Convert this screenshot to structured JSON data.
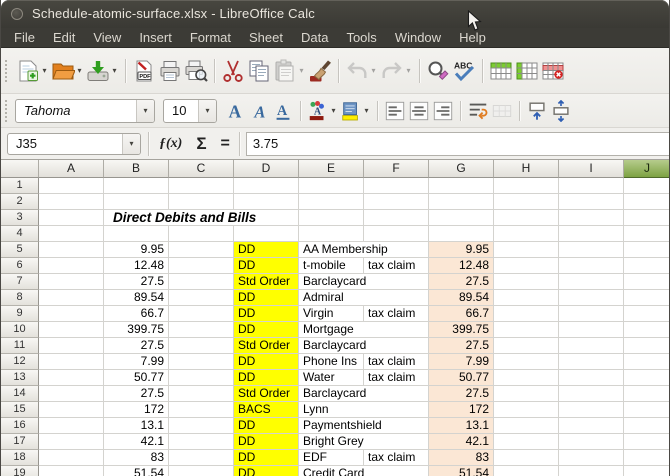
{
  "window": {
    "title": "Schedule-atomic-surface.xlsx - LibreOffice Calc"
  },
  "menubar": {
    "items": [
      "File",
      "Edit",
      "View",
      "Insert",
      "Format",
      "Sheet",
      "Data",
      "Tools",
      "Window",
      "Help"
    ]
  },
  "standard_toolbar": [
    {
      "icon": "new-document",
      "dropdown": true
    },
    {
      "icon": "open",
      "dropdown": true
    },
    {
      "icon": "save",
      "dropdown": true
    },
    {
      "type": "separator"
    },
    {
      "icon": "export-pdf"
    },
    {
      "icon": "print"
    },
    {
      "icon": "print-preview"
    },
    {
      "type": "separator"
    },
    {
      "icon": "cut"
    },
    {
      "icon": "copy"
    },
    {
      "icon": "paste",
      "dropdown": true,
      "disabled": true
    },
    {
      "icon": "clone-formatting"
    },
    {
      "type": "separator"
    },
    {
      "icon": "undo",
      "dropdown": true,
      "disabled": true
    },
    {
      "icon": "redo",
      "dropdown": true,
      "disabled": true
    },
    {
      "type": "separator"
    },
    {
      "icon": "find-and-replace"
    },
    {
      "icon": "spelling"
    },
    {
      "type": "separator"
    },
    {
      "icon": "insert-row"
    },
    {
      "icon": "insert-column"
    },
    {
      "icon": "delete-row"
    }
  ],
  "formatting": {
    "font_name": "Tahoma",
    "font_size": "10",
    "buttons": [
      {
        "icon": "bold"
      },
      {
        "icon": "italic"
      },
      {
        "icon": "underline"
      },
      {
        "type": "separator"
      },
      {
        "icon": "font-color",
        "dropdown": true
      },
      {
        "icon": "highlighting-color",
        "dropdown": true
      },
      {
        "type": "separator"
      },
      {
        "icon": "align-left"
      },
      {
        "icon": "align-center"
      },
      {
        "icon": "align-right"
      },
      {
        "type": "separator"
      },
      {
        "icon": "wrap-text"
      },
      {
        "icon": "merge-cells",
        "disabled": true
      },
      {
        "type": "separator"
      },
      {
        "icon": "align-top"
      },
      {
        "icon": "center-vertically"
      }
    ]
  },
  "formula_bar": {
    "name_box": "J35",
    "formula": "3.75",
    "icons": [
      "function-wizard",
      "sum",
      "formula"
    ]
  },
  "grid": {
    "columns": [
      "A",
      "B",
      "C",
      "D",
      "E",
      "F",
      "G",
      "H",
      "I",
      "J"
    ],
    "selected_column": "J",
    "rows_visible": 19,
    "section_title": {
      "row": 3,
      "column": "B",
      "text": "Direct Debits and Bills"
    },
    "records": [
      {
        "row": 5,
        "amount": "9.95",
        "method": "DD",
        "payee": "AA Membership",
        "note": "",
        "amount_copy": "9.95"
      },
      {
        "row": 6,
        "amount": "12.48",
        "method": "DD",
        "payee": "t-mobile",
        "note": "tax claim",
        "amount_copy": "12.48"
      },
      {
        "row": 7,
        "amount": "27.5",
        "method": "Std Order",
        "payee": "Barclaycard",
        "note": "",
        "amount_copy": "27.5"
      },
      {
        "row": 8,
        "amount": "89.54",
        "method": "DD",
        "payee": "Admiral",
        "note": "",
        "amount_copy": "89.54"
      },
      {
        "row": 9,
        "amount": "66.7",
        "method": "DD",
        "payee": "Virgin",
        "note": "tax claim",
        "amount_copy": "66.7"
      },
      {
        "row": 10,
        "amount": "399.75",
        "method": "DD",
        "payee": "Mortgage",
        "note": "",
        "amount_copy": "399.75"
      },
      {
        "row": 11,
        "amount": "27.5",
        "method": "Std Order",
        "payee": "Barclaycard",
        "note": "",
        "amount_copy": "27.5"
      },
      {
        "row": 12,
        "amount": "7.99",
        "method": "DD",
        "payee": "Phone Ins",
        "note": "tax claim",
        "amount_copy": "7.99"
      },
      {
        "row": 13,
        "amount": "50.77",
        "method": "DD",
        "payee": "Water",
        "note": "tax claim",
        "amount_copy": "50.77"
      },
      {
        "row": 14,
        "amount": "27.5",
        "method": "Std Order",
        "payee": "Barclaycard",
        "note": "",
        "amount_copy": "27.5"
      },
      {
        "row": 15,
        "amount": "172",
        "method": "BACS",
        "payee": "Lynn",
        "note": "",
        "amount_copy": "172"
      },
      {
        "row": 16,
        "amount": "13.1",
        "method": "DD",
        "payee": "Paymentshield",
        "note": "",
        "amount_copy": "13.1"
      },
      {
        "row": 17,
        "amount": "42.1",
        "method": "DD",
        "payee": "Bright Grey",
        "note": "",
        "amount_copy": "42.1"
      },
      {
        "row": 18,
        "amount": "83",
        "method": "DD",
        "payee": "EDF",
        "note": "tax claim",
        "amount_copy": "83"
      },
      {
        "row": 19,
        "amount": "51.54",
        "method": "DD",
        "payee": "Credit Card",
        "note": "",
        "amount_copy": "51.54"
      }
    ]
  },
  "colors": {
    "method_highlight": "#ffff00",
    "amount_copy_fill": "#fbe7d5",
    "selected_header_top": "#b6cc8d",
    "selected_header_bottom": "#7da243",
    "titlebar_bg": "#3c3b36"
  }
}
